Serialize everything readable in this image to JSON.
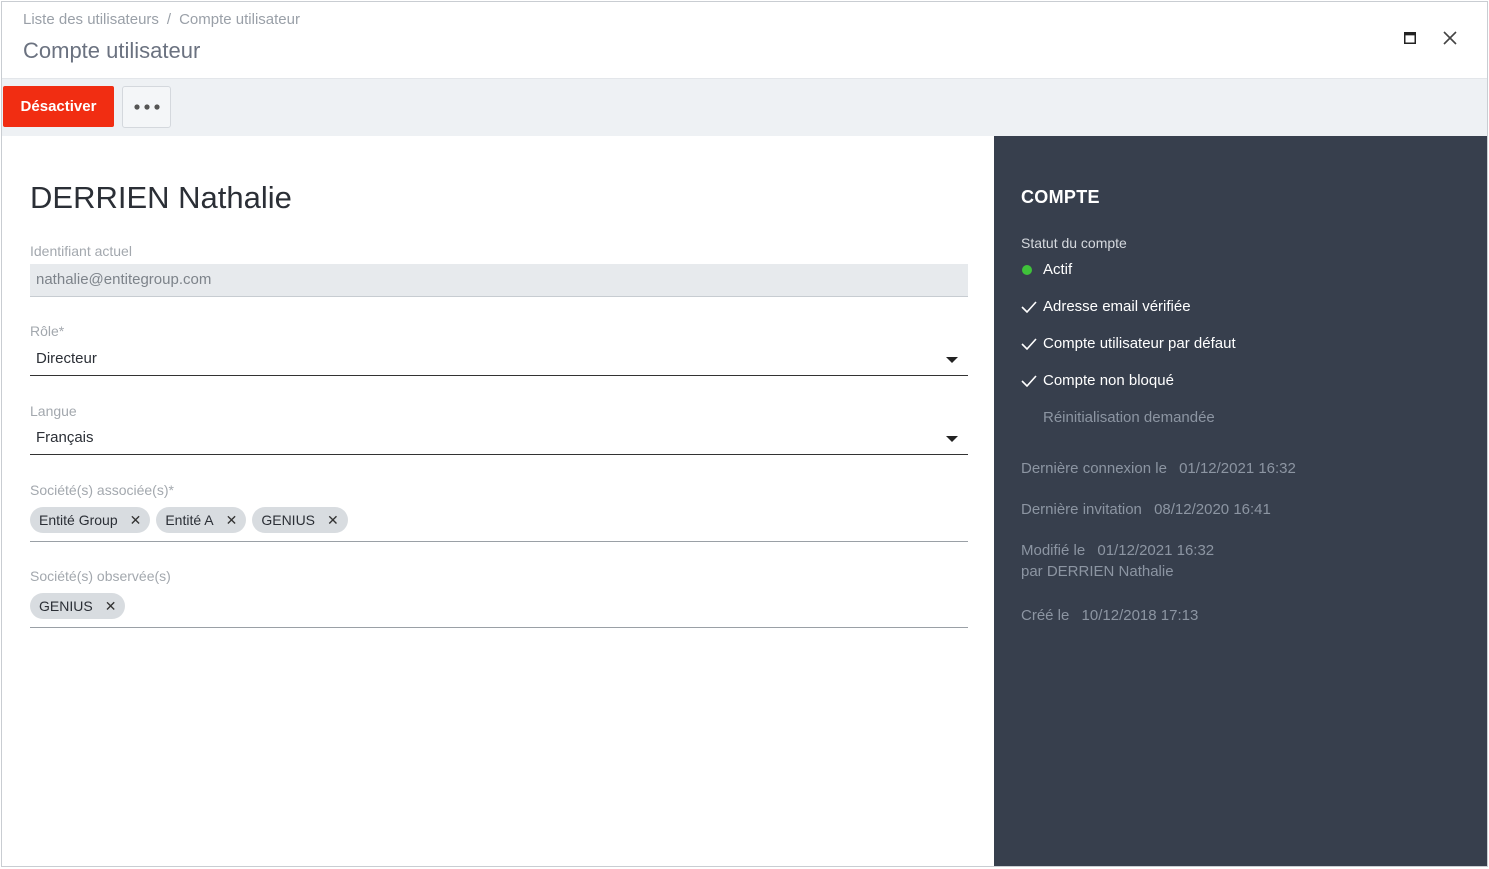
{
  "breadcrumb": {
    "parent": "Liste des utilisateurs",
    "separator": "/",
    "current": "Compte utilisateur"
  },
  "page_title": "Compte utilisateur",
  "window_controls": [
    "maximize-icon",
    "close-icon"
  ],
  "toolbar": {
    "deactivate_label": "Désactiver",
    "more_icon": "more-horizontal-icon"
  },
  "user": {
    "name": "DERRIEN Nathalie"
  },
  "fields": {
    "identifier": {
      "label": "Identifiant actuel",
      "value": "nathalie@entitegroup.com"
    },
    "role": {
      "label": "Rôle*",
      "value": "Directeur"
    },
    "language": {
      "label": "Langue",
      "value": "Français"
    },
    "associated": {
      "label": "Société(s) associée(s)*",
      "chips": [
        "Entité Group",
        "Entité A",
        "GENIUS"
      ]
    },
    "observed": {
      "label": "Société(s) observée(s)",
      "chips": [
        "GENIUS"
      ]
    }
  },
  "account_panel": {
    "title": "COMPTE",
    "status_label": "Statut du compte",
    "status_value": "Actif",
    "checks": [
      "Adresse email vérifiée",
      "Compte utilisateur par défaut",
      "Compte non bloqué"
    ],
    "reset": "Réinitialisation demandée",
    "last_login_label": "Dernière connexion le",
    "last_login_value": "01/12/2021 16:32",
    "last_invite_label": "Dernière invitation",
    "last_invite_value": "08/12/2020 16:41",
    "modified_label": "Modifié le",
    "modified_value": "01/12/2021 16:32",
    "modified_by": "par DERRIEN Nathalie",
    "created_label": "Créé le",
    "created_value": "10/12/2018 17:13"
  },
  "colors": {
    "danger": "#f12d12",
    "panel_bg": "#373f4d",
    "status_active": "#3fc23a"
  }
}
